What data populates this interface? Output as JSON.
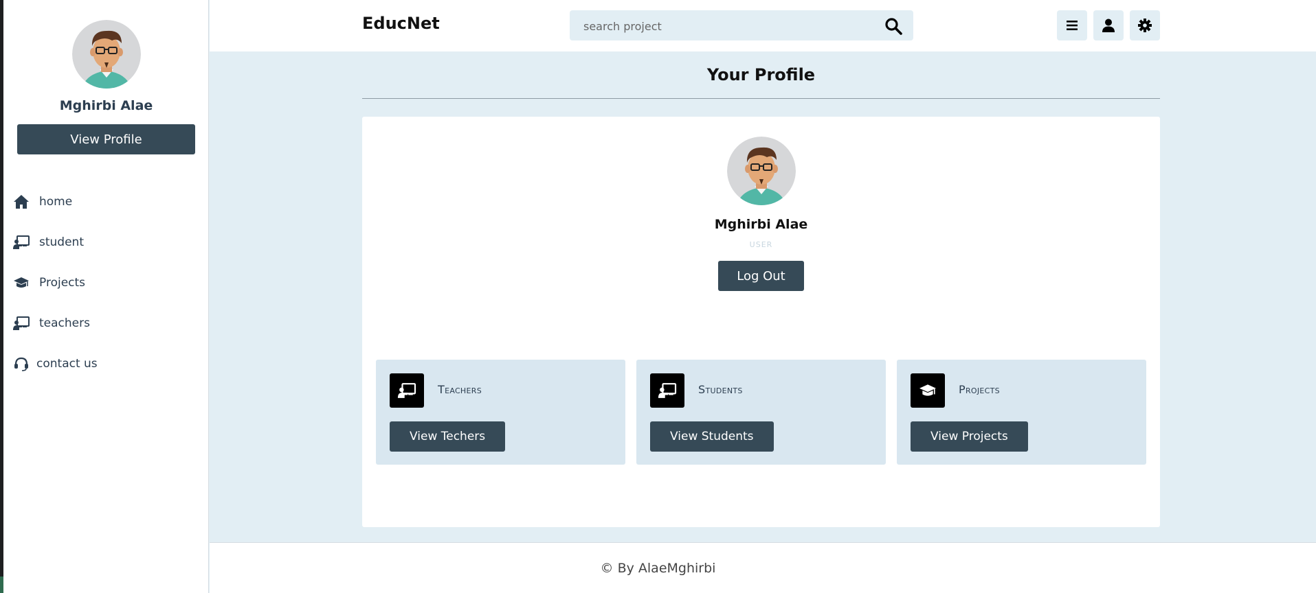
{
  "sidebar": {
    "user_name": "Mghirbi Alae",
    "view_profile_label": "View Profile",
    "items": [
      {
        "label": "home",
        "icon": "home-icon"
      },
      {
        "label": "student",
        "icon": "chalkboard-teacher-icon"
      },
      {
        "label": "Projects",
        "icon": "graduation-cap-icon"
      },
      {
        "label": "teachers",
        "icon": "chalkboard-teacher-icon"
      },
      {
        "label": "contact us",
        "icon": "headset-icon"
      }
    ]
  },
  "header": {
    "brand": "EducNet",
    "search_placeholder": "search project",
    "buttons": [
      "menu-icon",
      "user-icon",
      "gear-icon"
    ]
  },
  "main": {
    "title": "Your Profile",
    "profile": {
      "name": "Mghirbi Alae",
      "role": "USER",
      "logout_label": "Log Out"
    },
    "boxes": [
      {
        "title": "Teachers",
        "button_label": "View Techers",
        "icon": "chalkboard-teacher-icon"
      },
      {
        "title": "Students",
        "button_label": "View Students",
        "icon": "chalkboard-teacher-icon"
      },
      {
        "title": "Projects",
        "button_label": "View Projects",
        "icon": "graduation-cap-icon"
      }
    ]
  },
  "footer": {
    "text": "© By AlaeMghirbi"
  },
  "colors": {
    "primary_button": "#364a57",
    "background": "#e2eef4",
    "box_background": "#d9e7f0",
    "text_dark": "#2c3e50"
  }
}
